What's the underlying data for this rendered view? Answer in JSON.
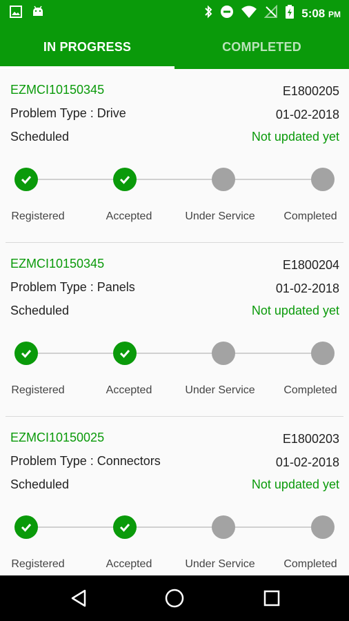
{
  "status_bar": {
    "time": "5:08",
    "ampm": "PM",
    "left_icons": [
      "image-icon",
      "android-icon"
    ],
    "right_icons": [
      "bluetooth-icon",
      "do-not-disturb-icon",
      "wifi-icon",
      "no-signal-icon",
      "battery-charging-icon"
    ]
  },
  "tabs": [
    {
      "label": "IN PROGRESS",
      "active": true
    },
    {
      "label": "COMPLETED",
      "active": false
    }
  ],
  "colors": {
    "brand": "#0a9a0a",
    "pending": "#a3a3a3"
  },
  "step_labels": [
    "Registered",
    "Accepted",
    "Under Service",
    "Completed"
  ],
  "requests": [
    {
      "id": "EZMCI10150345",
      "code": "E1800205",
      "problem_type": "Problem Type : Drive",
      "date": "01-02-2018",
      "status": "Scheduled",
      "update": "Not updated yet",
      "steps_done": 2
    },
    {
      "id": "EZMCI10150345",
      "code": "E1800204",
      "problem_type": "Problem Type : Panels",
      "date": "01-02-2018",
      "status": "Scheduled",
      "update": "Not updated yet",
      "steps_done": 2
    },
    {
      "id": "EZMCI10150025",
      "code": "E1800203",
      "problem_type": "Problem Type : Connectors",
      "date": "01-02-2018",
      "status": "Scheduled",
      "update": "Not updated yet",
      "steps_done": 2
    }
  ],
  "nav": [
    "back-icon",
    "home-icon",
    "recents-icon"
  ]
}
